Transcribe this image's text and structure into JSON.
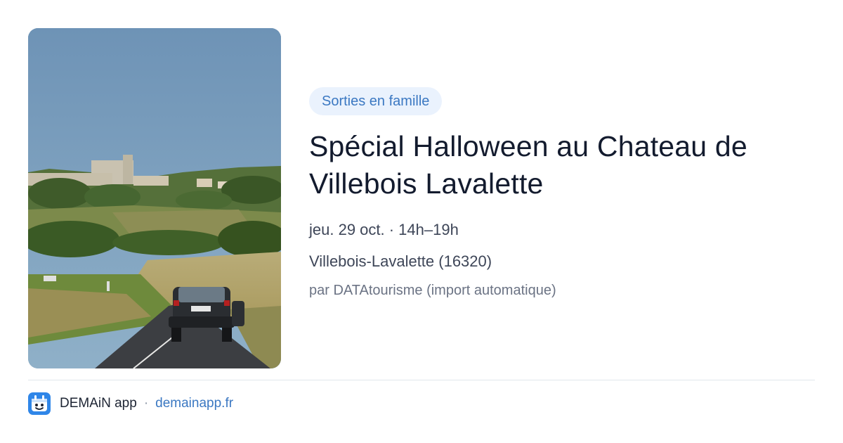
{
  "image": {
    "alt_semantic": "castle-village-road-photo"
  },
  "event": {
    "category": "Sorties en famille",
    "title_line1": "Spécial Halloween au Chateau de",
    "title_line2": "Villebois Lavalette",
    "date": "jeu. 29 oct. · 14h–19h",
    "location": "Villebois-Lavalette (16320)",
    "source": "par DATAtourisme (import automatique)"
  },
  "footer": {
    "app_name": "DEMAiN app",
    "separator": "·",
    "link": "demainapp.fr"
  },
  "colors": {
    "accent": "#3b78c2",
    "pill_bg": "#eaf2fd",
    "title": "#131b2e",
    "text": "#3e4658",
    "muted": "#6b7384"
  }
}
